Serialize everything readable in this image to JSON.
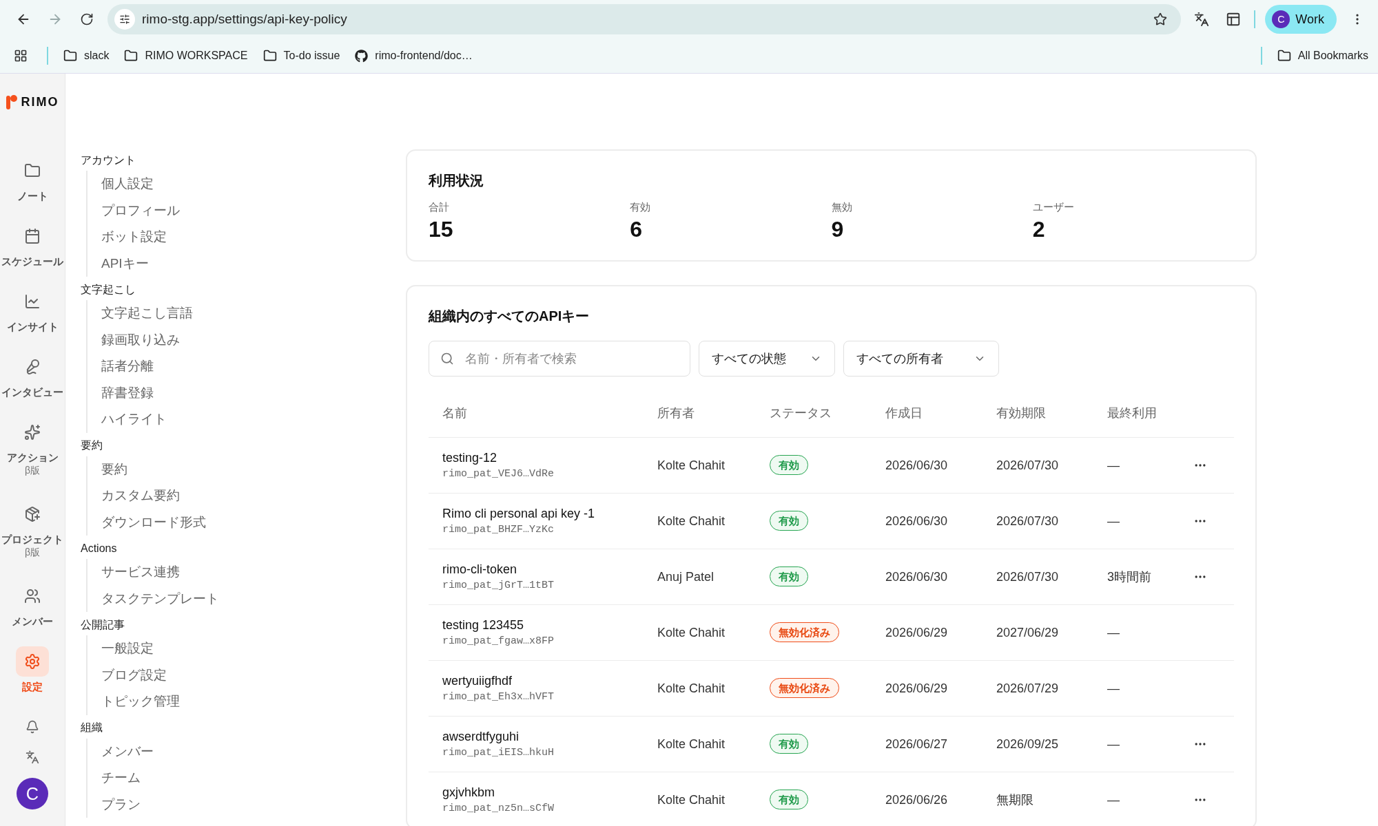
{
  "browser": {
    "url": "rimo-stg.app/settings/api-key-policy",
    "profile": {
      "initial": "C",
      "label": "Work"
    },
    "bookmarks": [
      {
        "label": "slack",
        "kind": "folder"
      },
      {
        "label": "RIMO WORKSPACE",
        "kind": "folder"
      },
      {
        "label": "To-do issue",
        "kind": "folder"
      },
      {
        "label": "rimo-frontend/doc…",
        "kind": "github"
      }
    ],
    "all_bookmarks": "All Bookmarks"
  },
  "logo": "RIMO",
  "rail": {
    "items": [
      {
        "label": "ノート",
        "selected": false
      },
      {
        "label": "スケジュール",
        "selected": false
      },
      {
        "label": "インサイト",
        "selected": false
      },
      {
        "label": "インタビュー",
        "selected": false
      },
      {
        "label": "アクション",
        "badge": "β版",
        "selected": false
      },
      {
        "label": "プロジェクト",
        "badge": "β版",
        "selected": false
      },
      {
        "label": "メンバー",
        "selected": false
      },
      {
        "label": "設定",
        "selected": true
      }
    ],
    "avatar": "C"
  },
  "settings_nav": [
    {
      "title": "アカウント",
      "items": [
        "個人設定",
        "プロフィール",
        "ボット設定",
        "APIキー"
      ]
    },
    {
      "title": "文字起こし",
      "items": [
        "文字起こし言語",
        "録画取り込み",
        "話者分離",
        "辞書登録",
        "ハイライト"
      ]
    },
    {
      "title": "要約",
      "items": [
        "要約",
        "カスタム要約",
        "ダウンロード形式"
      ]
    },
    {
      "title": "Actions",
      "items": [
        "サービス連携",
        "タスクテンプレート"
      ]
    },
    {
      "title": "公開記事",
      "items": [
        "一般設定",
        "ブログ設定",
        "トピック管理"
      ]
    },
    {
      "title": "組織",
      "items": [
        "メンバー",
        "チーム",
        "プラン"
      ]
    }
  ],
  "usage": {
    "title": "利用状況",
    "stats": [
      {
        "label": "合計",
        "value": "15"
      },
      {
        "label": "有効",
        "value": "6"
      },
      {
        "label": "無効",
        "value": "9"
      },
      {
        "label": "ユーザー",
        "value": "2"
      }
    ]
  },
  "api_keys": {
    "title": "組織内のすべてのAPIキー",
    "search": {
      "placeholder": "名前・所有者で検索"
    },
    "filters": [
      "すべての状態",
      "すべての所有者"
    ],
    "columns": [
      "名前",
      "所有者",
      "ステータス",
      "作成日",
      "有効期限",
      "最終利用"
    ],
    "rows": [
      {
        "name": "testing-12",
        "token": "rimo_pat_VEJ6…VdRe",
        "owner": "Kolte Chahit",
        "status": {
          "kind": "active",
          "label": "有効"
        },
        "created": "2026/06/30",
        "expires": "2026/07/30",
        "last_used": "—",
        "menu": true
      },
      {
        "name": "Rimo cli personal api key -1",
        "token": "rimo_pat_BHZF…YzKc",
        "owner": "Kolte Chahit",
        "status": {
          "kind": "active",
          "label": "有効"
        },
        "created": "2026/06/30",
        "expires": "2026/07/30",
        "last_used": "—",
        "menu": true
      },
      {
        "name": "rimo-cli-token",
        "token": "rimo_pat_jGrT…1tBT",
        "owner": "Anuj Patel",
        "status": {
          "kind": "active",
          "label": "有効"
        },
        "created": "2026/06/30",
        "expires": "2026/07/30",
        "last_used": "3時間前",
        "menu": true
      },
      {
        "name": "testing 123455",
        "token": "rimo_pat_fgaw…x8FP",
        "owner": "Kolte Chahit",
        "status": {
          "kind": "revoked",
          "label": "無効化済み"
        },
        "created": "2026/06/29",
        "expires": "2027/06/29",
        "last_used": "—",
        "menu": false
      },
      {
        "name": "wertyuiigfhdf",
        "token": "rimo_pat_Eh3x…hVFT",
        "owner": "Kolte Chahit",
        "status": {
          "kind": "revoked",
          "label": "無効化済み"
        },
        "created": "2026/06/29",
        "expires": "2026/07/29",
        "last_used": "—",
        "menu": false
      },
      {
        "name": "awserdtfyguhi",
        "token": "rimo_pat_iEIS…hkuH",
        "owner": "Kolte Chahit",
        "status": {
          "kind": "active",
          "label": "有効"
        },
        "created": "2026/06/27",
        "expires": "2026/09/25",
        "last_used": "—",
        "menu": true
      },
      {
        "name": "gxjvhkbm",
        "token": "rimo_pat_nz5n…sCfW",
        "owner": "Kolte Chahit",
        "status": {
          "kind": "active",
          "label": "有効"
        },
        "created": "2026/06/26",
        "expires": "無期限",
        "last_used": "—",
        "menu": true
      }
    ]
  }
}
